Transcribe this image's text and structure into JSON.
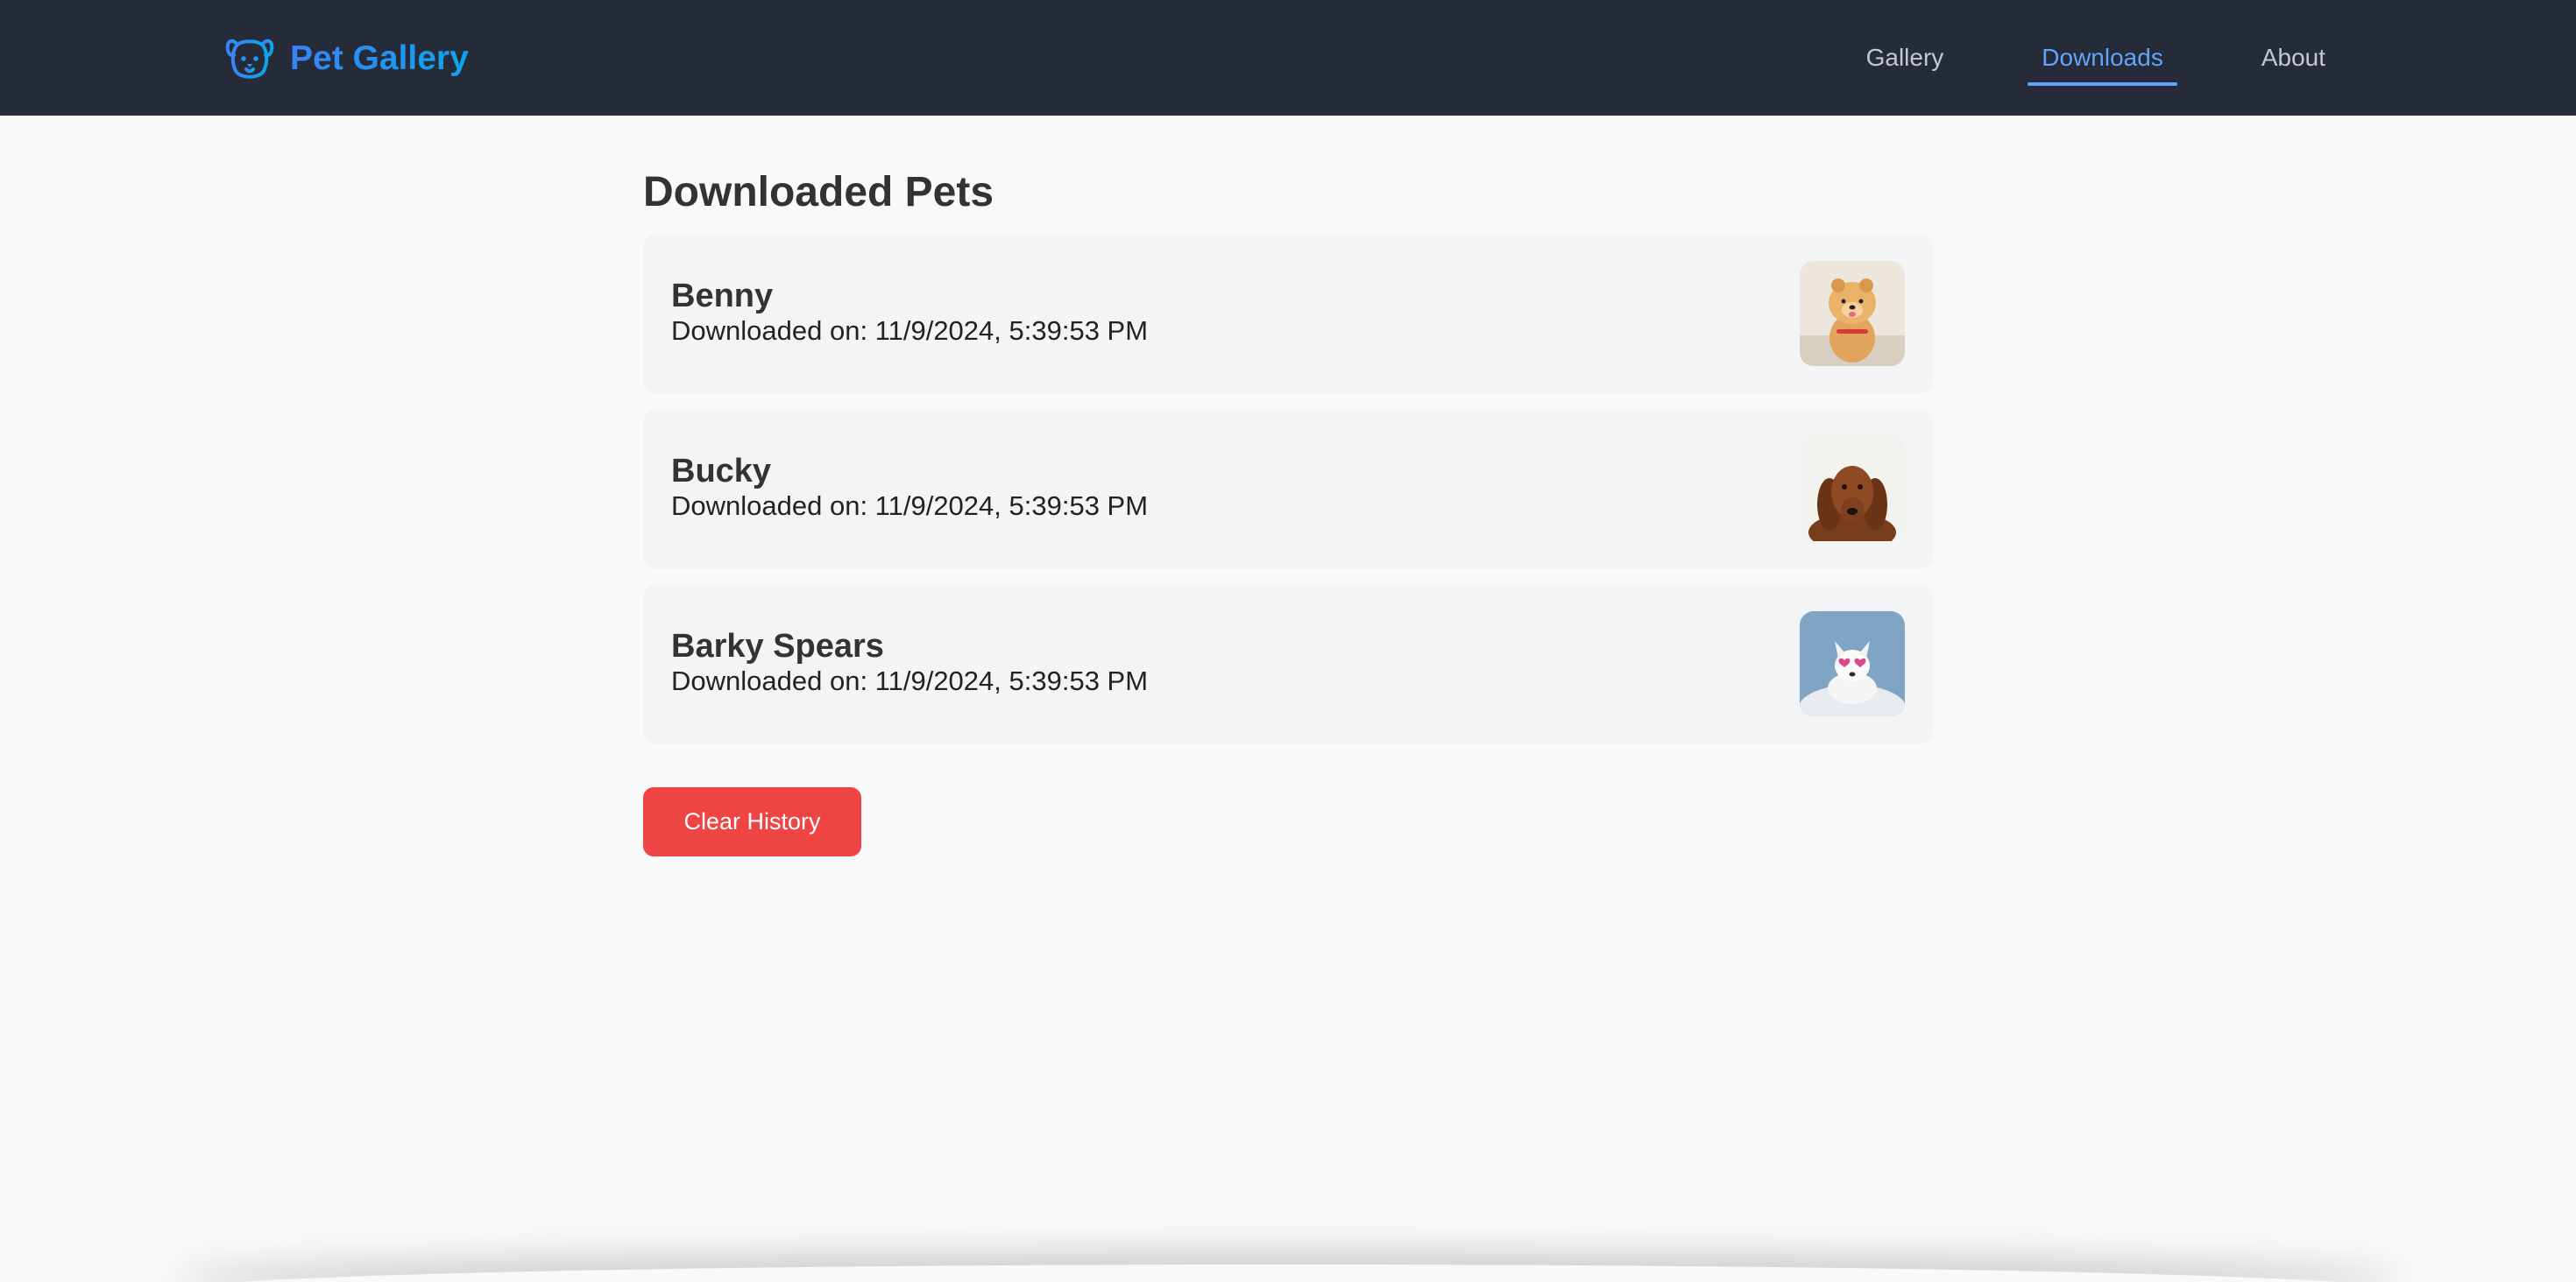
{
  "app": {
    "brand_name": "Pet Gallery",
    "brand_icon": "dog-face-icon"
  },
  "nav": {
    "items": [
      {
        "label": "Gallery",
        "active": false
      },
      {
        "label": "Downloads",
        "active": true
      },
      {
        "label": "About",
        "active": false
      }
    ]
  },
  "main": {
    "title": "Downloaded Pets",
    "downloads": [
      {
        "name": "Benny",
        "date": "Downloaded on: 11/9/2024, 5:39:53 PM",
        "thumbnail": "pomeranian-photo"
      },
      {
        "name": "Bucky",
        "date": "Downloaded on: 11/9/2024, 5:39:53 PM",
        "thumbnail": "dachshund-photo"
      },
      {
        "name": "Barky Spears",
        "date": "Downloaded on: 11/9/2024, 5:39:53 PM",
        "thumbnail": "white-dog-heart-glasses-photo"
      }
    ],
    "clear_button": "Clear History"
  },
  "colors": {
    "navbar_bg": "#262b3a",
    "accent": "#60a5fa",
    "danger": "#ef4444",
    "page_bg": "#f9f9f9",
    "card_bg": "#f3f4f6"
  }
}
